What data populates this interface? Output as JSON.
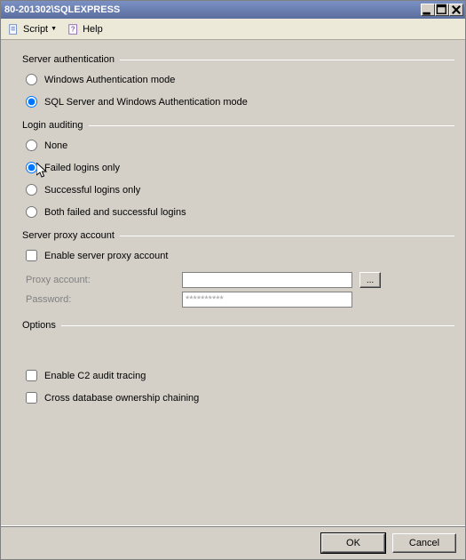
{
  "titlebar": {
    "text": "80-201302\\SQLEXPRESS"
  },
  "toolbar": {
    "script_label": "Script",
    "help_label": "Help"
  },
  "sections": {
    "server_auth": {
      "title": "Server authentication",
      "opt_windows": "Windows Authentication mode",
      "opt_sql_windows": "SQL Server and Windows Authentication mode"
    },
    "login_audit": {
      "title": "Login auditing",
      "opt_none": "None",
      "opt_failed": "Failed logins only",
      "opt_success": "Successful logins only",
      "opt_both": "Both failed and successful logins"
    },
    "proxy": {
      "title": "Server proxy account",
      "chk_enable": "Enable server proxy account",
      "lbl_account": "Proxy account:",
      "lbl_password": "Password:",
      "password_mask": "**********",
      "browse": "..."
    },
    "options": {
      "title": "Options",
      "chk_c2": "Enable C2 audit tracing",
      "chk_cross": "Cross database ownership chaining"
    }
  },
  "buttons": {
    "ok": "OK",
    "cancel": "Cancel"
  }
}
